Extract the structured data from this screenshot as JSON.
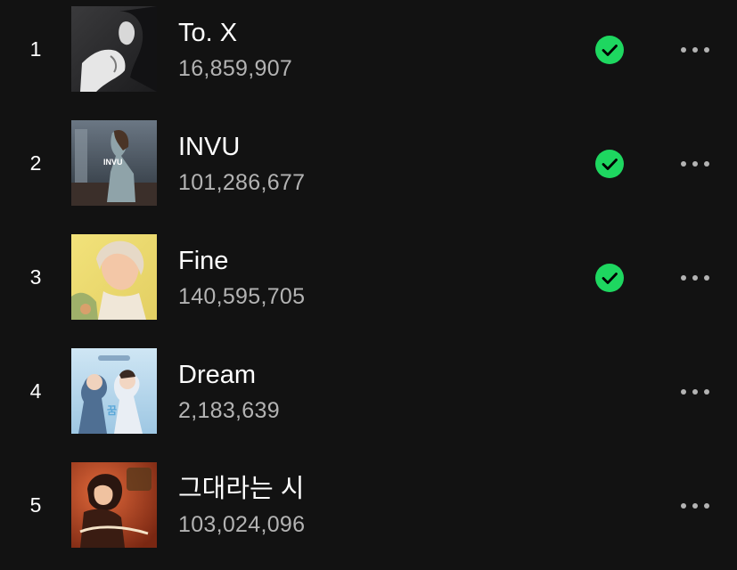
{
  "colors": {
    "background": "#121212",
    "title": "#ffffff",
    "plays": "#b3b3b3",
    "saved_green": "#1ed760",
    "more_dots": "#b3b3b3"
  },
  "icons": {
    "saved": "check-circle-icon",
    "more": "more-horizontal-icon"
  },
  "tracks": [
    {
      "index": "1",
      "title": "To. X",
      "plays": "16,859,907",
      "saved": true
    },
    {
      "index": "2",
      "title": "INVU",
      "plays": "101,286,677",
      "saved": true,
      "cover_text": "INVU"
    },
    {
      "index": "3",
      "title": "Fine",
      "plays": "140,595,705",
      "saved": true
    },
    {
      "index": "4",
      "title": "Dream",
      "plays": "2,183,639",
      "saved": false
    },
    {
      "index": "5",
      "title": "그대라는 시",
      "plays": "103,024,096",
      "saved": false
    }
  ]
}
